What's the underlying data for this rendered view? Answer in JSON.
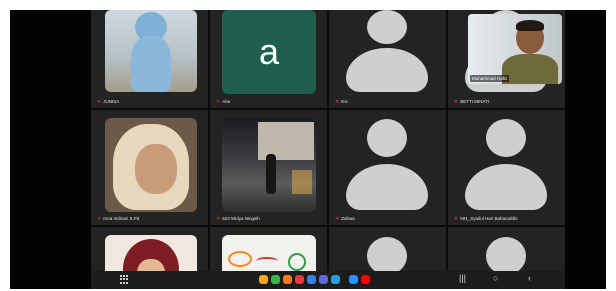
{
  "participants": [
    {
      "name": "JUNISA",
      "type": "photo"
    },
    {
      "name": "Abe",
      "type": "letter",
      "letter": "a"
    },
    {
      "name": "Evi",
      "type": "avatar"
    },
    {
      "name": "BETTI MINATI",
      "type": "avatar",
      "overlay": {
        "name": "Muhammad Hafiz"
      }
    },
    {
      "name": "Irma Indriani S.Pd",
      "type": "photo"
    },
    {
      "name": "624 Widya Ningsih",
      "type": "photo"
    },
    {
      "name": "Zahwa",
      "type": "avatar"
    },
    {
      "name": "591_Syaiful Hari Baharuddin",
      "type": "avatar"
    },
    {
      "name": "",
      "type": "photo"
    },
    {
      "name": "",
      "type": "photo"
    },
    {
      "name": "",
      "type": "avatar"
    },
    {
      "name": "",
      "type": "avatar"
    }
  ],
  "mic_muted_glyph": "✕",
  "letter_tile_color": "#1f5f4d",
  "taskbar": {
    "apps": [
      {
        "icon": "grid-icon"
      },
      {
        "icon": "gallery-icon",
        "color": "#f5a623"
      },
      {
        "icon": "phone-icon",
        "color": "#3bb54a"
      },
      {
        "icon": "contacts-icon",
        "color": "#f57c1f"
      },
      {
        "icon": "camera-icon",
        "color": "#e83a3a"
      },
      {
        "icon": "messages-icon",
        "color": "#3d7be8"
      },
      {
        "icon": "chat-icon",
        "color": "#5b6bd6"
      },
      {
        "icon": "play-store-icon",
        "color": "#2b9bd9"
      },
      {
        "icon": "zoom-icon",
        "color": "#2d8cff"
      },
      {
        "icon": "youtube-icon",
        "color": "#ff0000"
      }
    ],
    "nav": {
      "recents": "|||",
      "home": "○",
      "back": "‹"
    }
  }
}
